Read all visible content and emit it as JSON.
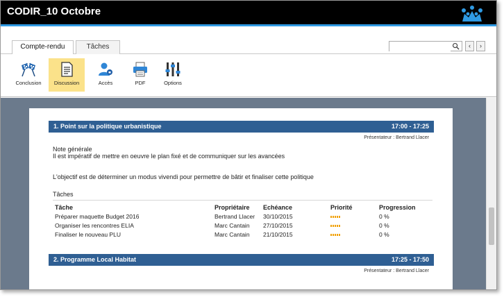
{
  "window": {
    "title": "CODIR_10 Octobre"
  },
  "tabs": [
    {
      "label": "Compte-rendu",
      "active": true
    },
    {
      "label": "Tâches",
      "active": false
    }
  ],
  "search": {
    "value": "",
    "placeholder": ""
  },
  "nav": {
    "prev": "‹",
    "next": "›"
  },
  "toolbar": [
    {
      "label": "Conclusion",
      "icon": "checkered-flags-icon"
    },
    {
      "label": "Discussion",
      "icon": "document-icon",
      "selected": true
    },
    {
      "label": "Accès",
      "icon": "user-access-icon"
    },
    {
      "label": "PDF",
      "icon": "printer-icon"
    },
    {
      "label": "Options",
      "icon": "sliders-icon"
    }
  ],
  "document": {
    "topics": [
      {
        "title": "1. Point sur la politique urbanistique",
        "time": "17:00 - 17:25",
        "presenter": "Présentateur : Bertrand Llacer",
        "note_heading": "Note générale",
        "note_line1": "Il est impératif de mettre en oeuvre le plan fixé et de communiquer sur les avancées",
        "note_line2": "L'objectif est de déterminer un modus vivendi pour permettre de bâtir et finaliser cette politique",
        "tasks_heading": "Tâches",
        "task_columns": [
          "Tâche",
          "Propriétaire",
          "Echéance",
          "Priorité",
          "Progression"
        ],
        "tasks": [
          {
            "name": "Préparer maquette Budget 2016",
            "owner": "Bertrand Llacer",
            "due": "30/10/2015",
            "progress": "0 %"
          },
          {
            "name": "Organiser les rencontres ELIA",
            "owner": "Marc Cantain",
            "due": "27/10/2015",
            "progress": "0 %"
          },
          {
            "name": "Finaliser le nouveau PLU",
            "owner": "Marc Cantain",
            "due": "21/10/2015",
            "progress": "0 %"
          }
        ]
      },
      {
        "title": "2. Programme Local Habitat",
        "time": "17:25 - 17:50",
        "presenter": "Présentateur : Bertrand Llacer"
      }
    ]
  },
  "colors": {
    "accent": "#2f9ae3",
    "band": "#2f5f93",
    "selected_tool": "#fbe28a",
    "priority": "#f1a000",
    "backdrop": "#6b7a8c"
  }
}
